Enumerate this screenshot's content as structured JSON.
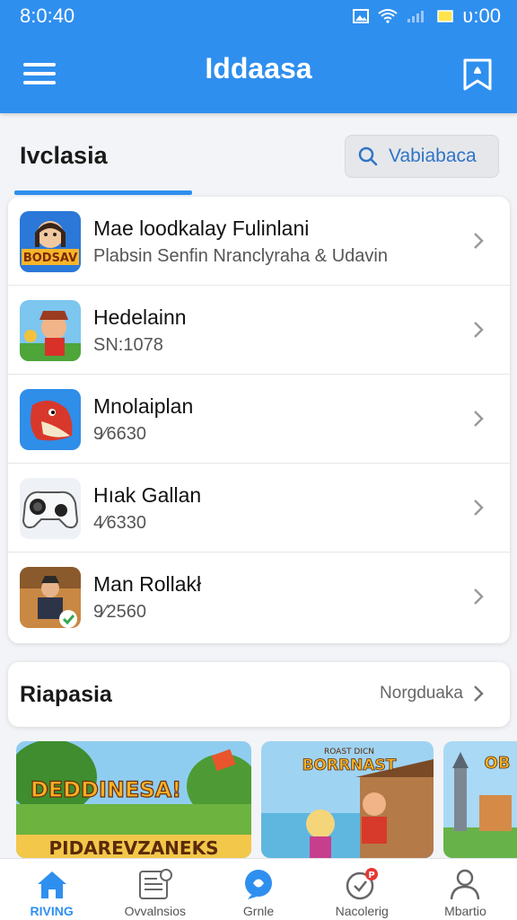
{
  "status_bar": {
    "time": "8:0:40",
    "battery_text": "ʋ:00"
  },
  "app": {
    "title": "Iddaasa"
  },
  "section": {
    "title": "Ivclasia",
    "search_label": "Vabiabaca"
  },
  "list": [
    {
      "title": "Mae loodkalay Fulinlani",
      "subtitle": "Plabsin Senfin Nranclyraha & Udavin",
      "thumb_text": "BODSAV"
    },
    {
      "title": "Hedelainn",
      "subtitle": "SN:1078"
    },
    {
      "title": "Mnolaiplan",
      "subtitle": "9⁄6630"
    },
    {
      "title": "Hıak Gallan",
      "subtitle": "4⁄6330"
    },
    {
      "title": "Man Rollakł",
      "subtitle": "9⁄2560"
    }
  ],
  "card2": {
    "title": "Riapasia",
    "more_label": "Norgduaka"
  },
  "banners": [
    {
      "headline": "DEDDINESA!",
      "footer": "PIDAREVZANEKS"
    },
    {
      "headline": "BORRNAST",
      "sub": "ROAST DICN"
    },
    {
      "headline": "OB"
    }
  ],
  "bottom_nav": [
    {
      "label": "RIVING",
      "icon": "home-icon",
      "active": true
    },
    {
      "label": "Ovvalnsios",
      "icon": "news-icon",
      "active": false
    },
    {
      "label": "Grnle",
      "icon": "chat-icon",
      "active": false
    },
    {
      "label": "Nacolerig",
      "icon": "notification-icon",
      "active": false
    },
    {
      "label": "Mbartio",
      "icon": "profile-icon",
      "active": false
    }
  ],
  "colors": {
    "primary": "#2f8fef",
    "background": "#f3f4f7",
    "notification_badge": "#e53935"
  }
}
